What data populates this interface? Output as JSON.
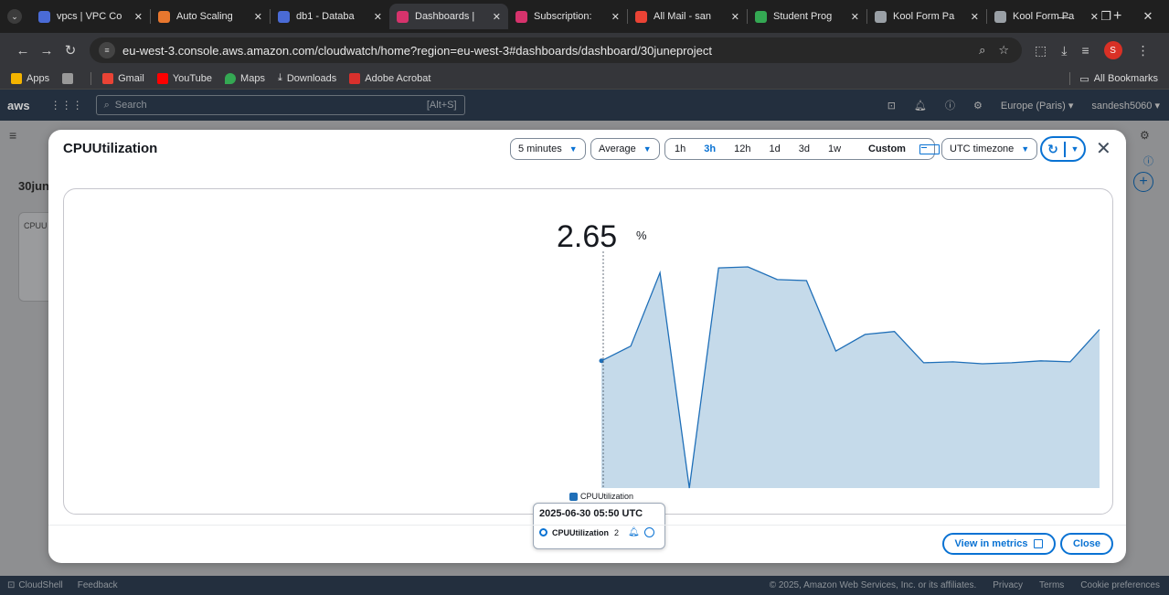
{
  "browser": {
    "tabs": [
      {
        "title": "vpcs | VPC Co",
        "color": "#4a6bd6"
      },
      {
        "title": "Auto Scaling",
        "color": "#e8772e"
      },
      {
        "title": "db1 - Databa",
        "color": "#4a6bd6"
      },
      {
        "title": "Dashboards |",
        "color": "#d6336c",
        "active": true
      },
      {
        "title": "Subscription:",
        "color": "#d6336c"
      },
      {
        "title": "All Mail - san",
        "color": "#ea4335"
      },
      {
        "title": "Student Prog",
        "color": "#34a853"
      },
      {
        "title": "Kool Form Pa",
        "color": "#9aa0a6"
      },
      {
        "title": "Kool Form Pa",
        "color": "#9aa0a6"
      }
    ],
    "url": "eu-west-3.console.aws.amazon.com/cloudwatch/home?region=eu-west-3#dashboards/dashboard/30juneproject",
    "profile_initial": "S",
    "bookmarks": [
      {
        "label": "Apps"
      },
      {
        "label": "Gmail"
      },
      {
        "label": "YouTube"
      },
      {
        "label": "Maps"
      },
      {
        "label": "Downloads"
      },
      {
        "label": "Adobe Acrobat"
      }
    ],
    "all_bookmarks": "All Bookmarks"
  },
  "aws": {
    "logo": "aws",
    "search_placeholder": "Search",
    "search_shortcut": "[Alt+S]",
    "region": "Europe (Paris) ▾",
    "user": "sandesh5060 ▾",
    "dashboard_title": "30jun",
    "widget_title": "CPUU",
    "footer": {
      "cloudshell": "CloudShell",
      "feedback": "Feedback",
      "copyright": "© 2025, Amazon Web Services, Inc. or its affiliates.",
      "privacy": "Privacy",
      "terms": "Terms",
      "cookies": "Cookie preferences"
    }
  },
  "modal": {
    "title": "CPUUtilization",
    "period": "5 minutes",
    "statistic": "Average",
    "ranges": [
      "1h",
      "3h",
      "12h",
      "1d",
      "3d",
      "1w"
    ],
    "active_range": "3h",
    "custom": "Custom",
    "timezone": "UTC timezone",
    "big_value": "2.65",
    "big_unit": "%",
    "legend": "CPUUtilization",
    "tooltip": {
      "time": "2025-06-30 05:50 UTC",
      "series": "CPUUtilization",
      "value": "2"
    },
    "view_in_metrics": "View in metrics",
    "close": "Close"
  },
  "chart_data": {
    "type": "area",
    "series": [
      {
        "name": "CPUUtilization",
        "values": [
          2.65,
          2.8,
          3.55,
          1.35,
          3.6,
          3.61,
          3.48,
          3.47,
          2.75,
          2.92,
          2.95,
          2.63,
          2.64,
          2.62,
          2.63,
          2.65,
          2.64,
          2.97
        ]
      }
    ],
    "ylim": [
      1.35,
      3.75
    ],
    "highlight_index": 0,
    "color": "#1f6fb8",
    "fill": "#c5daea"
  }
}
